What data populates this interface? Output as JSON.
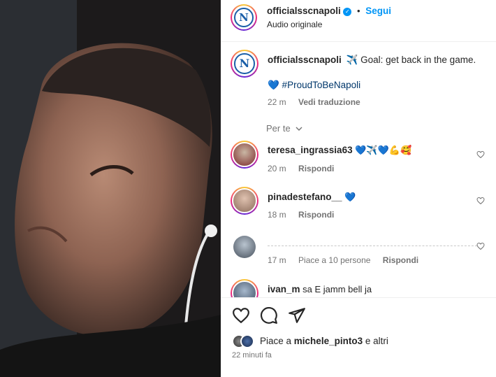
{
  "header": {
    "username": "officialsscnapoli",
    "separator": "•",
    "follow_label": "Segui",
    "audio_label": "Audio originale",
    "logo_letter": "N"
  },
  "caption": {
    "username": "officialsscnapoli",
    "text": "✈️ Goal: get back in the game.",
    "hashtag_line": "💙 #ProudToBeNapoli",
    "time": "22 m",
    "translate_label": "Vedi traduzione"
  },
  "for_you": {
    "label": "Per te"
  },
  "comments": [
    {
      "username": "teresa_ingrassia63",
      "text": "💙✈️💙💪🥰",
      "time": "20 m",
      "reply_label": "Rispondi",
      "likes": ""
    },
    {
      "username": "pinadestefano__",
      "text": "💙",
      "time": "18 m",
      "reply_label": "Rispondi",
      "likes": ""
    },
    {
      "username": "",
      "text": "",
      "time": "17 m",
      "reply_label": "Rispondi",
      "likes": "Piace a 10 persone"
    },
    {
      "username": "ivan_m",
      "text": "sa E jamm bell ja",
      "time": "",
      "reply_label": "",
      "likes": ""
    }
  ],
  "actions": {
    "liked_by_prefix": "Piace a",
    "liked_by_user": "michele_pinto3",
    "liked_by_suffix": "e altri",
    "timestamp": "22 minuti fa"
  },
  "colors": {
    "accent": "#0095f6",
    "napoli_blue": "#1b5fa8",
    "muted": "#737373"
  }
}
